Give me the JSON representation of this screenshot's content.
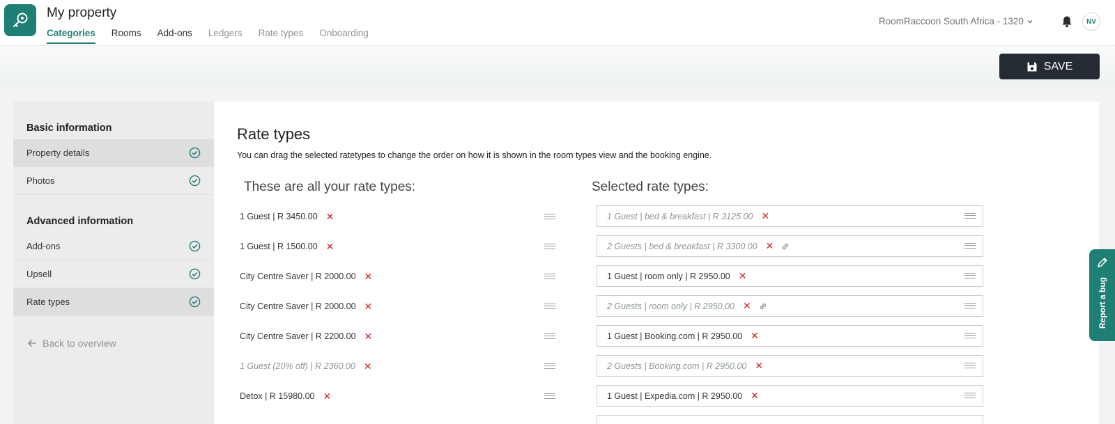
{
  "header": {
    "title": "My property",
    "tabs": [
      {
        "label": "Categories"
      },
      {
        "label": "Rooms"
      },
      {
        "label": "Add-ons"
      },
      {
        "label": "Ledgers"
      },
      {
        "label": "Rate types"
      },
      {
        "label": "Onboarding"
      }
    ],
    "account": "RoomRaccoon South Africa - 1320",
    "avatar": "NV"
  },
  "toolbar": {
    "save_label": "SAVE"
  },
  "sidebar": {
    "basic_heading": "Basic information",
    "advanced_heading": "Advanced information",
    "items": [
      {
        "label": "Property details"
      },
      {
        "label": "Photos"
      },
      {
        "label": "Add-ons"
      },
      {
        "label": "Upsell"
      },
      {
        "label": "Rate types"
      }
    ],
    "back": "Back to overview"
  },
  "main": {
    "title": "Rate types",
    "description": "You can drag the selected ratetypes to change the order on how it is shown in the room types view and the booking engine.",
    "all_heading": "These are all your rate types:",
    "selected_heading": "Selected rate types:",
    "all_rates": [
      {
        "label": "1 Guest | R 3450.00"
      },
      {
        "label": "1 Guest | R 1500.00"
      },
      {
        "label": "City Centre Saver | R 2000.00"
      },
      {
        "label": "City Centre Saver | R 2000.00"
      },
      {
        "label": "City Centre Saver | R 2200.00"
      },
      {
        "label": "1 Guest (20% off) | R 2360.00"
      },
      {
        "label": "Detox | R 15980.00"
      }
    ],
    "selected_rates": [
      {
        "label": "1 Guest | bed & breakfast | R 3125.00"
      },
      {
        "label": "2 Guests | bed & breakfast | R 3300.00"
      },
      {
        "label": "1 Guest | room only | R 2950.00"
      },
      {
        "label": "2 Guests | room only | R 2950.00"
      },
      {
        "label": "1 Guest | Booking.com | R 2950.00"
      },
      {
        "label": "2 Guests | Booking.com | R 2950.00"
      },
      {
        "label": "1 Guest | Expedia.com | R 2950.00"
      }
    ]
  },
  "bug_tab": {
    "label": "Report a bug"
  },
  "colors": {
    "accent": "#1f7f74",
    "delete": "#d42222",
    "save_bg": "#252b33"
  }
}
